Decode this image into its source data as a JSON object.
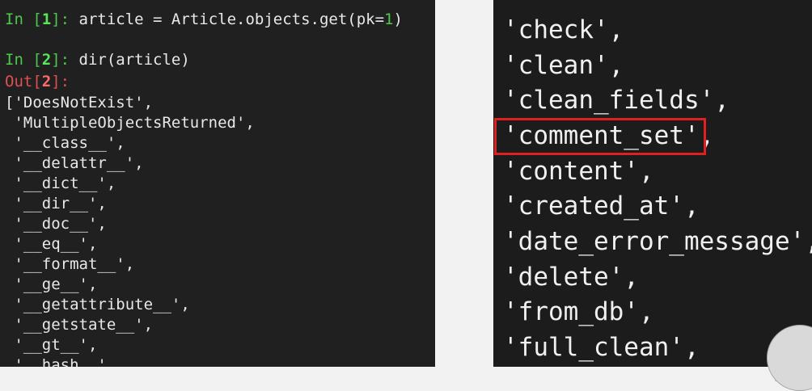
{
  "left_terminal": {
    "in1_prompt": "In [",
    "in1_num": "1",
    "in1_close": "]: ",
    "in1_code_a": "article = Article.objects.get(pk=",
    "in1_code_num": "1",
    "in1_code_b": ")",
    "in2_prompt": "In [",
    "in2_num": "2",
    "in2_close": "]: ",
    "in2_code": "dir(article)",
    "out2_prompt": "Out[",
    "out2_num": "2",
    "out2_close": "]:",
    "output_lines": [
      "['DoesNotExist',",
      " 'MultipleObjectsReturned',",
      " '__class__',",
      " '__delattr__',",
      " '__dict__',",
      " '__dir__',",
      " '__doc__',",
      " '__eq__',",
      " '__format__',",
      " '__ge__',",
      " '__getattribute__',",
      " '__getstate__',",
      " '__gt__',",
      " '__hash__',"
    ]
  },
  "right_terminal": {
    "lines": [
      "'check',",
      "'clean',",
      "'clean_fields',",
      "'comment_set',",
      "'content',",
      "'created_at',",
      "'date_error_message',",
      "'delete',",
      "'from_db',",
      "'full_clean',"
    ],
    "highlighted_item": "'comment_set',"
  },
  "colors": {
    "terminal_bg": "#202020",
    "prompt_green": "#4ec74e",
    "out_red": "#e05050",
    "highlight_border": "#e02020",
    "text": "#e8e8e8"
  },
  "icons": {
    "presenter": "presenter-avatar"
  }
}
